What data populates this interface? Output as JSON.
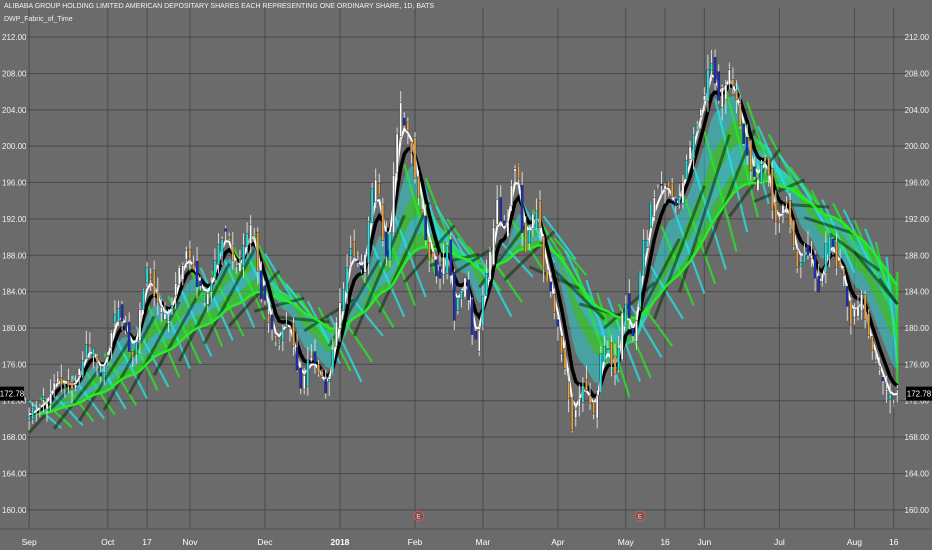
{
  "header": {
    "symbol_line": "ALIBABA GROUP HOLDING LIMITED AMERICAN DEPOSITARY SHARES EACH REPRESENTING ONE ORDINARY SHARE, 1D, BATS",
    "indicator_name": "DWP_Fabric_of_Time"
  },
  "price_badge": {
    "label": "172.78",
    "value": 172.78
  },
  "markers": {
    "earnings": "E"
  },
  "colors": {
    "background": "#6b6b6b",
    "grid": "#4a4a4a",
    "fabric_green": "#22ee22",
    "fabric_cyan": "#22e6e6",
    "fabric_dark": "#0a2e0a",
    "ribbon_white": "#ffffff",
    "ribbon_black": "#000000",
    "bull_candle": "#ffffff",
    "bear_candle": "#e8a040"
  },
  "chart_data": {
    "type": "candlestick",
    "title": "ALIBABA GROUP HOLDING LIMITED AMERICAN DEPOSITARY SHARES EACH REPRESENTING ONE ORDINARY SHARE, 1D, BATS",
    "indicator": "DWP_Fabric_of_Time",
    "ylim": [
      158,
      213
    ],
    "y_ticks": [
      160.0,
      164.0,
      168.0,
      172.0,
      176.0,
      180.0,
      184.0,
      188.0,
      192.0,
      196.0,
      200.0,
      204.0,
      208.0,
      212.0
    ],
    "y_tick_labels": [
      "160.00",
      "164.00",
      "168.00",
      "172.00",
      "176.00",
      "180.00",
      "184.00",
      "188.00",
      "192.00",
      "196.00",
      "200.00",
      "204.00",
      "208.00",
      "212.00"
    ],
    "x_ticks": [
      {
        "label": "Sep",
        "bar": 0
      },
      {
        "label": "Oct",
        "bar": 22
      },
      {
        "label": "17",
        "bar": 33
      },
      {
        "label": "Nov",
        "bar": 45
      },
      {
        "label": "Dec",
        "bar": 66
      },
      {
        "label": "2018",
        "bar": 87
      },
      {
        "label": "Feb",
        "bar": 108
      },
      {
        "label": "Mar",
        "bar": 127
      },
      {
        "label": "Apr",
        "bar": 148
      },
      {
        "label": "May",
        "bar": 167
      },
      {
        "label": "16",
        "bar": 178
      },
      {
        "label": "Jun",
        "bar": 189
      },
      {
        "label": "Jul",
        "bar": 210
      },
      {
        "label": "Aug",
        "bar": 231
      },
      {
        "label": "16",
        "bar": 242
      }
    ],
    "xlim": [
      -2,
      246
    ],
    "grid": true,
    "last_price": 172.78,
    "earnings_marker_bars": [
      109,
      171
    ],
    "pivots": [
      [
        0,
        170.5
      ],
      [
        4,
        171.8
      ],
      [
        8,
        174.5
      ],
      [
        12,
        173.6
      ],
      [
        17,
        178.0
      ],
      [
        20,
        175.2
      ],
      [
        25,
        182.0
      ],
      [
        29,
        177.5
      ],
      [
        33,
        186.0
      ],
      [
        38,
        181.0
      ],
      [
        44,
        188.0
      ],
      [
        49,
        183.5
      ],
      [
        55,
        190.5
      ],
      [
        58,
        186.0
      ],
      [
        62,
        191.0
      ],
      [
        66,
        182.5
      ],
      [
        69,
        178.0
      ],
      [
        72,
        181.0
      ],
      [
        76,
        174.0
      ],
      [
        79,
        176.5
      ],
      [
        83,
        173.5
      ],
      [
        87,
        182.0
      ],
      [
        90,
        189.0
      ],
      [
        93,
        186.5
      ],
      [
        97,
        196.0
      ],
      [
        100,
        188.5
      ],
      [
        104,
        204.0
      ],
      [
        107,
        200.0
      ],
      [
        109,
        194.0
      ],
      [
        112,
        188.0
      ],
      [
        115,
        185.0
      ],
      [
        117,
        189.0
      ],
      [
        119,
        181.5
      ],
      [
        122,
        185.5
      ],
      [
        125,
        178.0
      ],
      [
        128,
        186.0
      ],
      [
        131,
        193.5
      ],
      [
        133,
        190.5
      ],
      [
        136,
        198.0
      ],
      [
        139,
        189.0
      ],
      [
        142,
        193.0
      ],
      [
        145,
        185.0
      ],
      [
        148,
        180.0
      ],
      [
        150,
        175.0
      ],
      [
        152,
        169.5
      ],
      [
        155,
        174.0
      ],
      [
        158,
        171.0
      ],
      [
        161,
        178.5
      ],
      [
        164,
        175.5
      ],
      [
        167,
        183.0
      ],
      [
        169,
        179.0
      ],
      [
        172,
        189.0
      ],
      [
        175,
        194.5
      ],
      [
        178,
        196.0
      ],
      [
        181,
        193.0
      ],
      [
        184,
        198.0
      ],
      [
        187,
        203.0
      ],
      [
        189,
        206.0
      ],
      [
        191,
        209.5
      ],
      [
        193,
        205.0
      ],
      [
        196,
        208.0
      ],
      [
        198,
        204.5
      ],
      [
        200,
        201.0
      ],
      [
        203,
        196.0
      ],
      [
        206,
        198.5
      ],
      [
        209,
        191.0
      ],
      [
        212,
        193.5
      ],
      [
        215,
        187.0
      ],
      [
        218,
        188.5
      ],
      [
        221,
        184.0
      ],
      [
        224,
        190.0
      ],
      [
        227,
        186.5
      ],
      [
        230,
        181.0
      ],
      [
        233,
        183.0
      ],
      [
        236,
        177.0
      ],
      [
        239,
        174.0
      ],
      [
        241,
        172.0
      ],
      [
        243,
        172.78
      ]
    ]
  }
}
